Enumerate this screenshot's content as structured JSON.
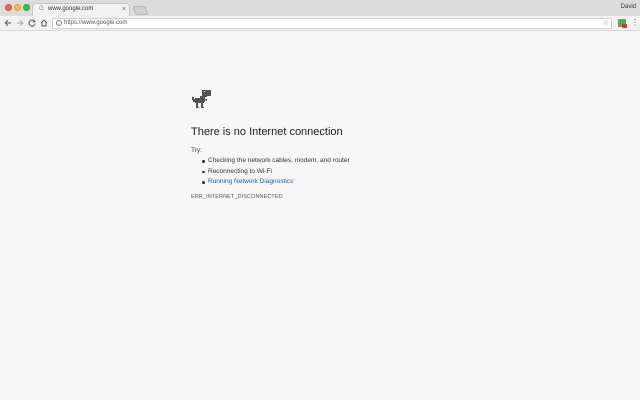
{
  "window": {
    "profile_name": "David"
  },
  "tab": {
    "title": "www.google.com",
    "favicon": "page-icon",
    "close_glyph": "×"
  },
  "toolbar": {
    "url": "https://www.google.com",
    "icons": [
      "back-arrow-icon",
      "forward-arrow-icon",
      "reload-icon",
      "home-icon",
      "info-icon",
      "star-icon",
      "extension-icon",
      "kebab-menu-icon"
    ]
  },
  "error_page": {
    "title": "There is no Internet connection",
    "try_label": "Try:",
    "suggestions": [
      "Checking the network cables, modem, and router",
      "Reconnecting to Wi-Fi",
      "Running Network Diagnostics"
    ],
    "error_code": "ERR_INTERNET_DISCONNECTED",
    "link_color": "#1a57c8"
  },
  "colors": {
    "page_background": "#f7f7f7",
    "titlebar": "#dcdcdc",
    "toolbar": "#f2f2f2"
  }
}
